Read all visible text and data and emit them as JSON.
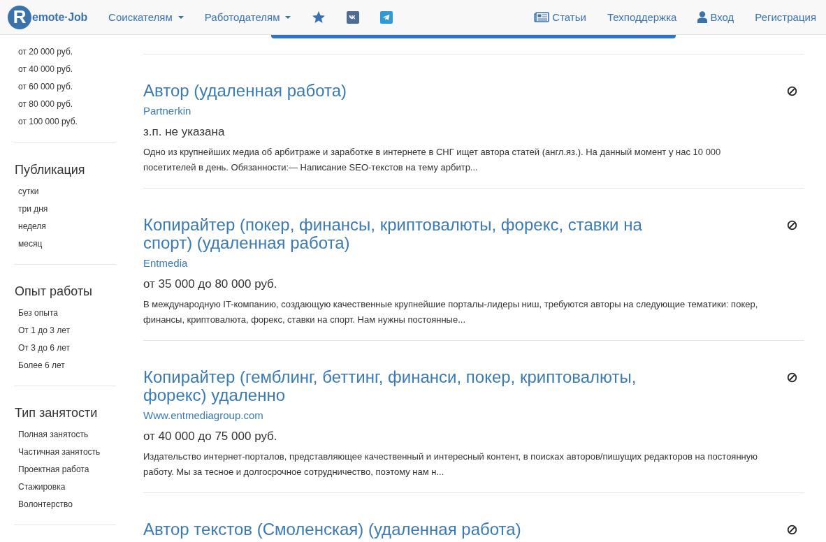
{
  "header": {
    "logo_badge": "R",
    "logo_text": "emote·Job",
    "nav_left": [
      {
        "label": "Соискателям",
        "kind": "dropdown"
      },
      {
        "label": "Работодателям",
        "kind": "dropdown"
      }
    ],
    "social": [
      {
        "kind": "star"
      },
      {
        "kind": "vk"
      },
      {
        "kind": "telegram"
      }
    ],
    "nav_right": [
      {
        "label": "Статьи",
        "kind": "articles"
      },
      {
        "label": "Техподдержка",
        "kind": "plain"
      },
      {
        "label": "Вход",
        "kind": "user"
      },
      {
        "label": "Регистрация",
        "kind": "plain"
      }
    ]
  },
  "sidebar": [
    {
      "items": [
        "от 20 000 руб.",
        "от 40 000 руб.",
        "от 60 000 руб.",
        "от 80 000 руб.",
        "от 100 000 руб."
      ]
    },
    {
      "heading": "Публикация",
      "items": [
        "сутки",
        "три дня",
        "неделя",
        "месяц"
      ]
    },
    {
      "heading": "Опыт работы",
      "items": [
        "Без опыта",
        "От 1 до 3 лет",
        "От 3 до 6 лет",
        "Более 6 лет"
      ]
    },
    {
      "heading": "Тип занятости",
      "items": [
        "Полная занятость",
        "Частичная занятость",
        "Проектная работа",
        "Стажировка",
        "Волонтерство"
      ]
    }
  ],
  "jobs": [
    {
      "title": "Автор (удаленная работа)",
      "company": "Partnerkin",
      "salary": "з.п. не указана",
      "description": "Одно из крупнейших медиа об арбитраже и заработке в интернете в СНГ ищет автора статей (англ.яз.). На данный момент у нас 10 000 посетителей в день. Обязанности:— Написание SEO-текстов на тему арбитр..."
    },
    {
      "title": "Копирайтер (покер, финансы, криптовалюты, форекс, ставки на спорт) (удаленная работа)",
      "company": "Entmedia",
      "salary": "от 35 000 до 80 000 руб.",
      "description": "В международную IT-компанию, создающую качественные крупнейшие порталы-лидеры ниш, требуются авторы на следующие тематики: покер, финансы, криптовалюта, форекс, ставки на спорт. Нам нужны постоянные..."
    },
    {
      "title": "Копирайтер (гемблинг, беттинг, финанси, покер, криптовалюты, форекс) удаленно",
      "company": "Www.entmediagroup.com",
      "salary": "от 40 000 до 75 000 руб.",
      "description": "Издательство интернет-порталов, представляющее качественный и интересный контент, в поисках авторов/пишущих редакторов на постоянную работу. Мы за тесное и долгосрочное сотрудничество, поэтому нам н..."
    },
    {
      "title": "Автор текстов (Смоленская) (удаленная работа)"
    }
  ]
}
